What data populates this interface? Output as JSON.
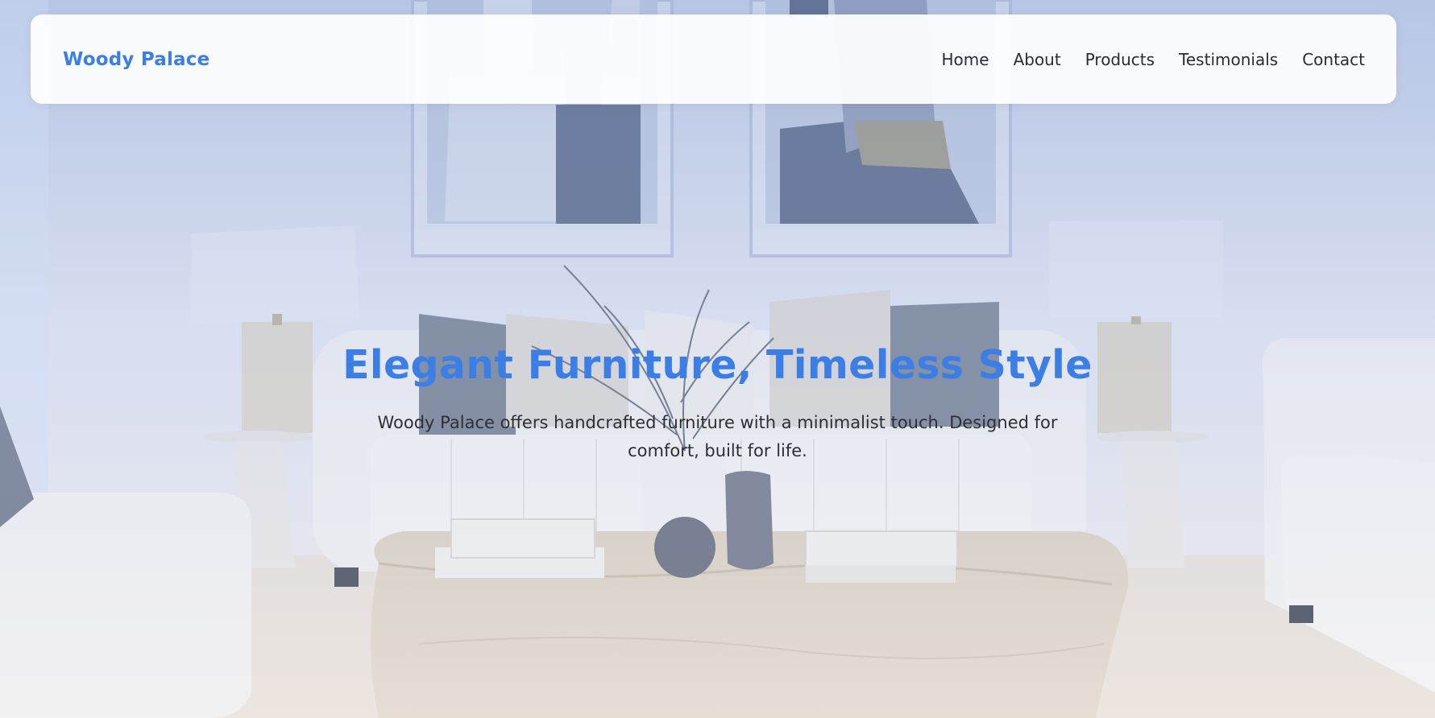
{
  "navbar": {
    "brand": "Woody Palace",
    "links": [
      {
        "label": "Home"
      },
      {
        "label": "About"
      },
      {
        "label": "Products"
      },
      {
        "label": "Testimonials"
      },
      {
        "label": "Contact"
      }
    ]
  },
  "hero": {
    "title": "Elegant Furniture, Timeless Style",
    "subtitle": "Woody Palace offers handcrafted furniture with a minimalist touch. Designed for comfort, built for life.",
    "background_image": "living-room-photo"
  },
  "colors": {
    "accent": "#3b7ee6",
    "text": "#2b2b33",
    "nav_bg": "#ffffff"
  }
}
